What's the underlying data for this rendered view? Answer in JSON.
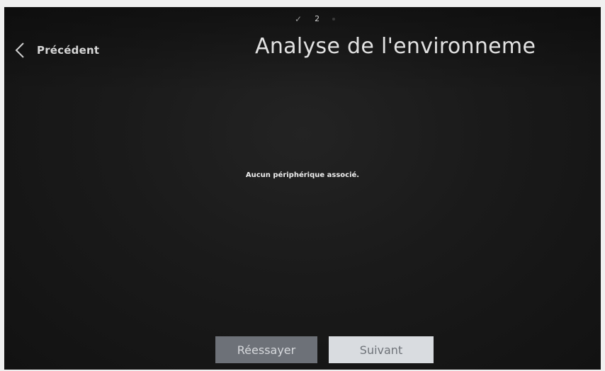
{
  "stepper": {
    "completed_mark": "✓",
    "current_step": "2"
  },
  "header": {
    "back_label": "Précédent",
    "title": "Analyse de l'environneme"
  },
  "main": {
    "message": "Aucun périphérique associé."
  },
  "actions": {
    "retry_label": "Réessayer",
    "next_label": "Suivant"
  },
  "colors": {
    "background": "#1a1a1a",
    "retry_button": "#6d7178",
    "next_button": "#d9dce0"
  }
}
